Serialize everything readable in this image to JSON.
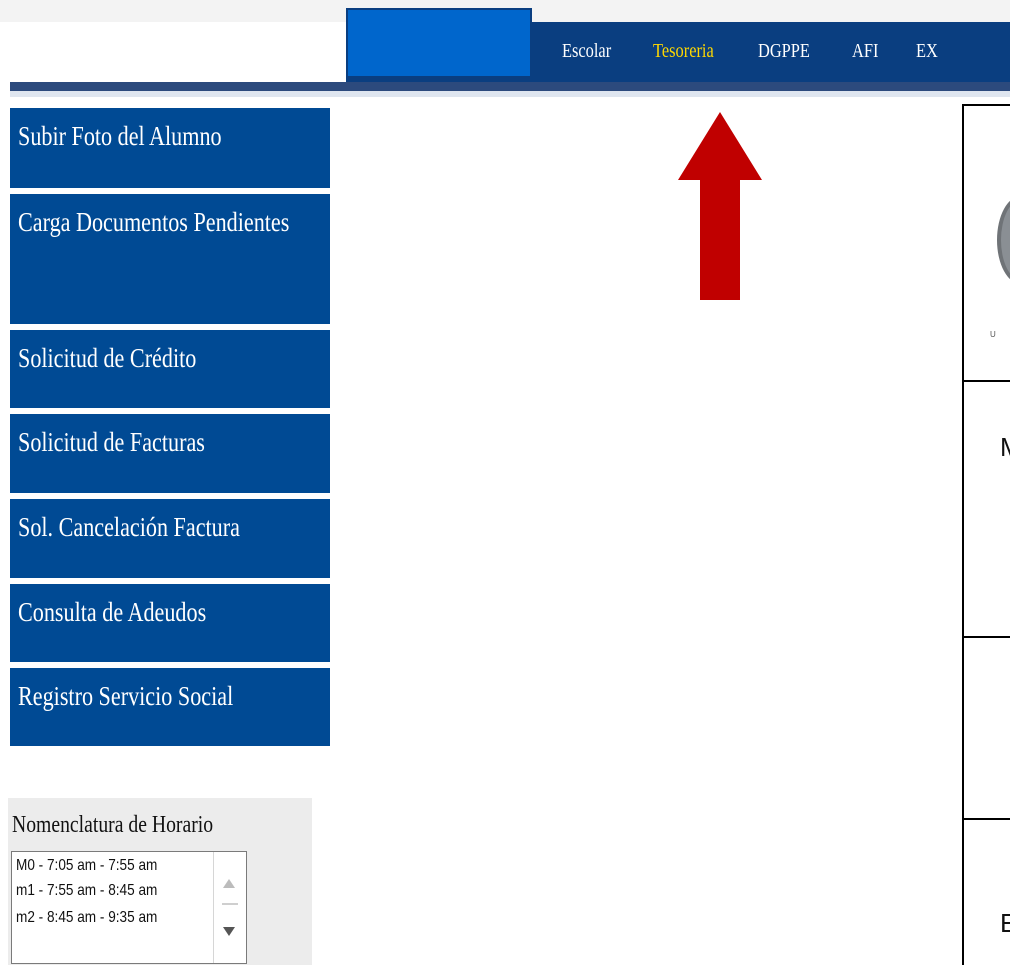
{
  "header": {
    "nav_items": [
      "Escolar",
      "Tesoreria",
      "DGPPE",
      "AFI",
      "EX"
    ],
    "active_item": "Tesoreria"
  },
  "sidebar": {
    "items": [
      {
        "label": "Subir Foto del Alumno"
      },
      {
        "label": "Carga Documentos Pendientes"
      },
      {
        "label": "Solicitud de Crédito"
      },
      {
        "label": "Solicitud de Facturas"
      },
      {
        "label": "Sol. Cancelación Factura"
      },
      {
        "label": "Consulta de Adeudos"
      },
      {
        "label": "Registro Servicio Social"
      }
    ]
  },
  "horario": {
    "title": "Nomenclatura de Horario",
    "options": [
      "M0 - 7:05 am - 7:55 am",
      "m1 - 7:55 am - 8:45 am",
      "m2 - 8:45 am - 9:35 am"
    ]
  },
  "panel": {
    "seal_text": "U",
    "letters": [
      "M",
      "E"
    ]
  },
  "colors": {
    "nav_bg": "#0a3e80",
    "menu_bg": "#004a94",
    "active_nav": "#ffd800",
    "arrow": "#c00000"
  },
  "annotations": {
    "arrow_direction": "up",
    "arrow_target": "Tesoreria"
  }
}
